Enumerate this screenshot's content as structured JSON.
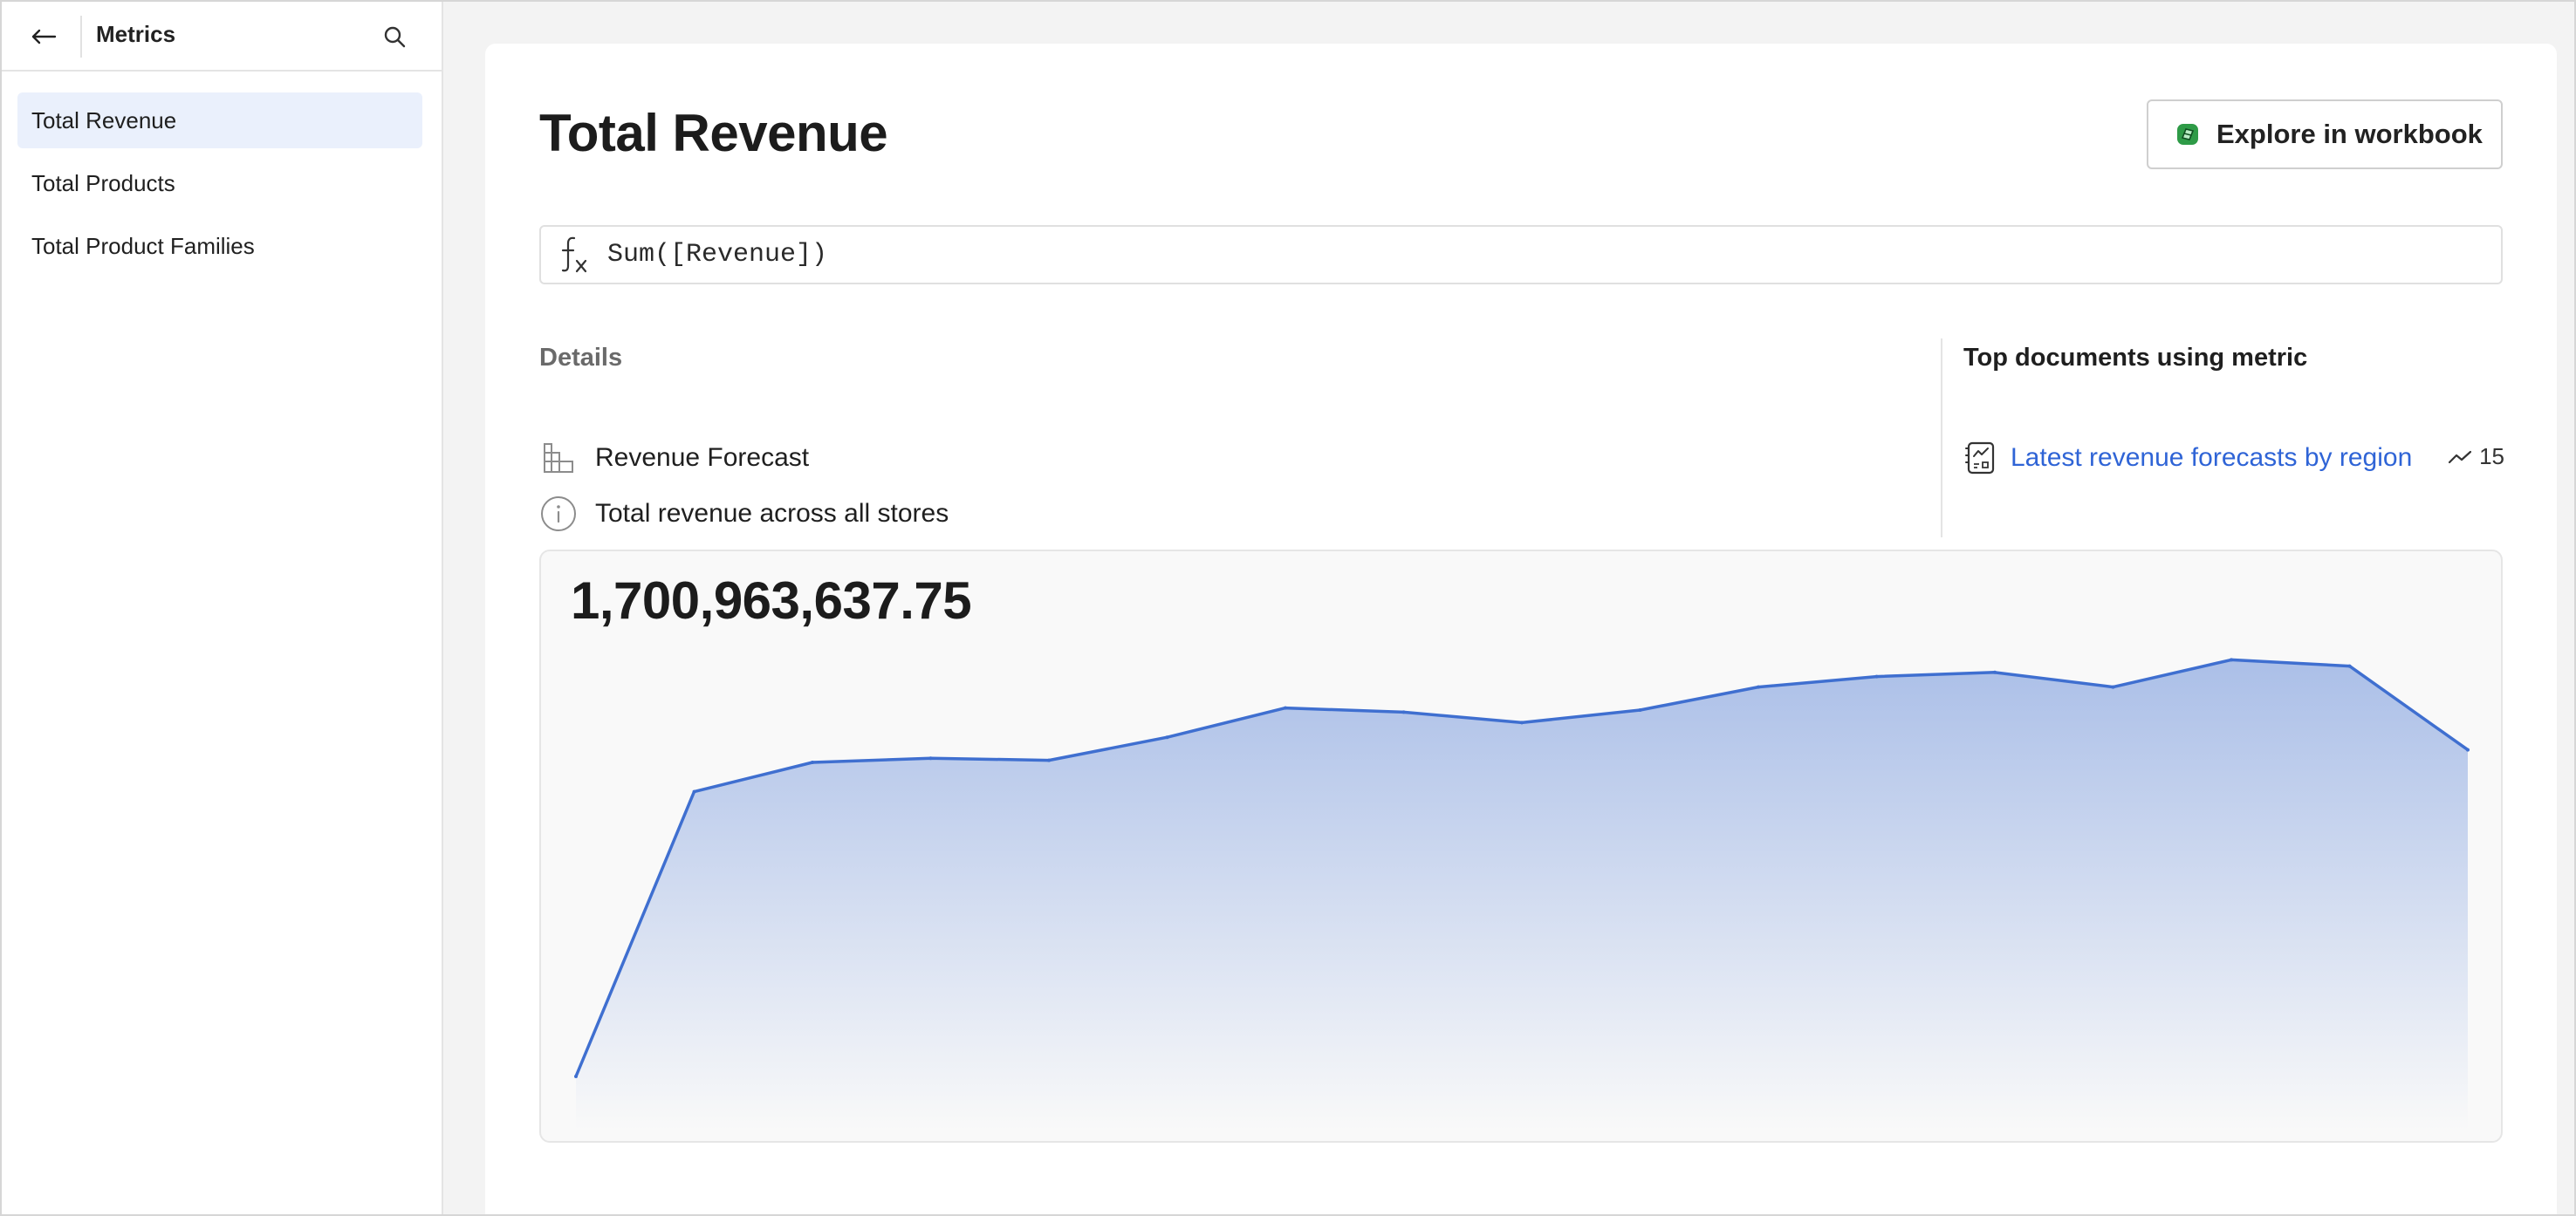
{
  "sidebar": {
    "title": "Metrics",
    "items": [
      {
        "label": "Total Revenue",
        "active": true
      },
      {
        "label": "Total Products",
        "active": false
      },
      {
        "label": "Total Product Families",
        "active": false
      }
    ]
  },
  "main": {
    "title": "Total Revenue",
    "explore_button": "Explore in workbook",
    "formula": "Sum([Revenue])",
    "details": {
      "heading": "Details",
      "source": "Revenue Forecast",
      "description": "Total revenue across all stores"
    },
    "top_documents": {
      "heading": "Top documents using metric",
      "items": [
        {
          "title": "Latest revenue forecasts by region",
          "count": "15"
        }
      ]
    },
    "value": "1,700,963,637.75"
  },
  "colors": {
    "accent": "#2f64d6",
    "line": "#3f6fd0",
    "active_bg": "#eaf0fc"
  },
  "chart_data": {
    "type": "area",
    "series": [
      {
        "values": [
          0.0,
          0.68,
          0.75,
          0.76,
          0.755,
          0.81,
          0.88,
          0.87,
          0.845,
          0.875,
          0.93,
          0.955,
          0.965,
          0.93,
          0.995,
          0.98,
          0.78
        ]
      }
    ],
    "ylim": [
      0,
      1
    ],
    "grid": false
  }
}
